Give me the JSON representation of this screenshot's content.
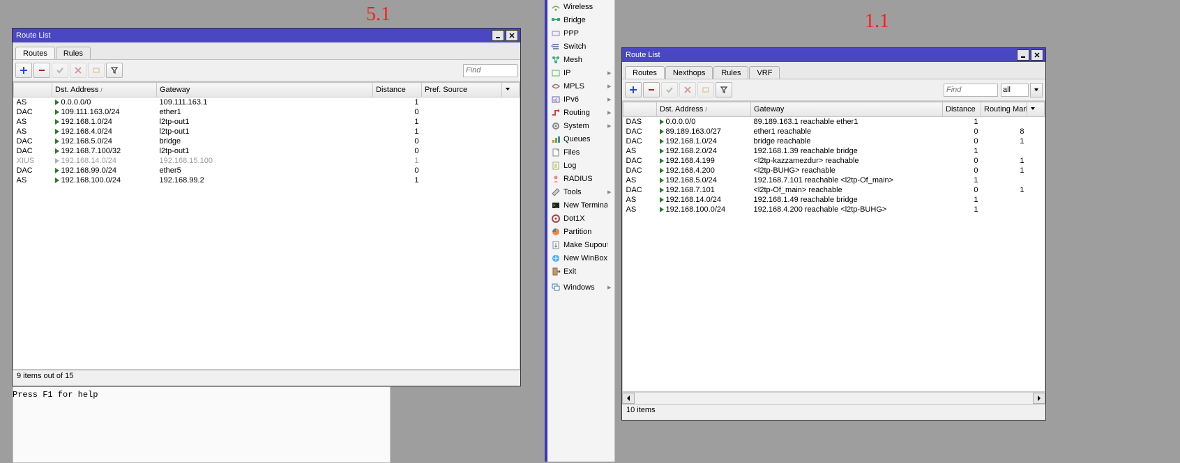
{
  "annotation_left": "5.1",
  "annotation_right": "1.1",
  "f1_help_text": "Press F1 for help",
  "window_a": {
    "title": "Route List",
    "tabs": [
      {
        "label": "Routes",
        "active": true
      },
      {
        "label": "Rules",
        "active": false
      }
    ],
    "find_placeholder": "Find",
    "columns": [
      "",
      "Dst. Address",
      "Gateway",
      "Distance",
      "Pref. Source"
    ],
    "rows": [
      {
        "flag": "AS",
        "dst": "0.0.0.0/0",
        "gw": "109.111.163.1",
        "dist": "1",
        "pref": ""
      },
      {
        "flag": "DAC",
        "dst": "109.111.163.0/24",
        "gw": "ether1",
        "dist": "0",
        "pref": ""
      },
      {
        "flag": "AS",
        "dst": "192.168.1.0/24",
        "gw": "l2tp-out1",
        "dist": "1",
        "pref": ""
      },
      {
        "flag": "AS",
        "dst": "192.168.4.0/24",
        "gw": "l2tp-out1",
        "dist": "1",
        "pref": ""
      },
      {
        "flag": "DAC",
        "dst": "192.168.5.0/24",
        "gw": "bridge",
        "dist": "0",
        "pref": ""
      },
      {
        "flag": "DAC",
        "dst": "192.168.7.100/32",
        "gw": "l2tp-out1",
        "dist": "0",
        "pref": ""
      },
      {
        "flag": "XIUS",
        "dst": "192.168.14.0/24",
        "gw": "192.168.15.100",
        "dist": "1",
        "pref": "",
        "disabled": true
      },
      {
        "flag": "DAC",
        "dst": "192.168.99.0/24",
        "gw": "ether5",
        "dist": "0",
        "pref": ""
      },
      {
        "flag": "AS",
        "dst": "192.168.100.0/24",
        "gw": "192.168.99.2",
        "dist": "1",
        "pref": ""
      }
    ],
    "status": "9 items out of 15"
  },
  "menu_items": [
    {
      "icon": "wireless",
      "label": "Wireless"
    },
    {
      "icon": "bridge",
      "label": "Bridge"
    },
    {
      "icon": "ppp",
      "label": "PPP"
    },
    {
      "icon": "switch",
      "label": "Switch"
    },
    {
      "icon": "mesh",
      "label": "Mesh"
    },
    {
      "icon": "ip",
      "label": "IP",
      "sub": true
    },
    {
      "icon": "mpls",
      "label": "MPLS",
      "sub": true
    },
    {
      "icon": "ipv6",
      "label": "IPv6",
      "sub": true
    },
    {
      "icon": "routing",
      "label": "Routing",
      "sub": true
    },
    {
      "icon": "system",
      "label": "System",
      "sub": true
    },
    {
      "icon": "queues",
      "label": "Queues"
    },
    {
      "icon": "files",
      "label": "Files"
    },
    {
      "icon": "log",
      "label": "Log"
    },
    {
      "icon": "radius",
      "label": "RADIUS"
    },
    {
      "icon": "tools",
      "label": "Tools",
      "sub": true
    },
    {
      "icon": "terminal",
      "label": "New Terminal"
    },
    {
      "icon": "dot1x",
      "label": "Dot1X"
    },
    {
      "icon": "partition",
      "label": "Partition"
    },
    {
      "icon": "supout",
      "label": "Make Supout.rif"
    },
    {
      "icon": "winbox",
      "label": "New WinBox"
    },
    {
      "icon": "exit",
      "label": "Exit"
    },
    {
      "separator": true
    },
    {
      "icon": "windows",
      "label": "Windows",
      "sub": true
    }
  ],
  "window_b": {
    "title": "Route List",
    "tabs": [
      {
        "label": "Routes",
        "active": true
      },
      {
        "label": "Nexthops",
        "active": false
      },
      {
        "label": "Rules",
        "active": false
      },
      {
        "label": "VRF",
        "active": false
      }
    ],
    "find_placeholder": "Find",
    "all_label": "all",
    "columns": [
      "",
      "Dst. Address",
      "Gateway",
      "Distance",
      "Routing Mark"
    ],
    "rows": [
      {
        "flag": "DAS",
        "dst": "0.0.0.0/0",
        "gw": "89.189.163.1 reachable ether1",
        "dist": "1",
        "mark": ""
      },
      {
        "flag": "DAC",
        "dst": "89.189.163.0/27",
        "gw": "ether1 reachable",
        "dist": "0",
        "mark": "8"
      },
      {
        "flag": "DAC",
        "dst": "192.168.1.0/24",
        "gw": "bridge reachable",
        "dist": "0",
        "mark": "1"
      },
      {
        "flag": "AS",
        "dst": "192.168.2.0/24",
        "gw": "192.168.1.39 reachable bridge",
        "dist": "1",
        "mark": ""
      },
      {
        "flag": "DAC",
        "dst": "192.168.4.199",
        "gw": "<l2tp-kazzamezdur> reachable",
        "dist": "0",
        "mark": "1"
      },
      {
        "flag": "DAC",
        "dst": "192.168.4.200",
        "gw": "<l2tp-BUHG> reachable",
        "dist": "0",
        "mark": "1"
      },
      {
        "flag": "AS",
        "dst": "192.168.5.0/24",
        "gw": "192.168.7.101 reachable <l2tp-Of_main>",
        "dist": "1",
        "mark": ""
      },
      {
        "flag": "DAC",
        "dst": "192.168.7.101",
        "gw": "<l2tp-Of_main> reachable",
        "dist": "0",
        "mark": "1"
      },
      {
        "flag": "AS",
        "dst": "192.168.14.0/24",
        "gw": "192.168.1.49 reachable bridge",
        "dist": "1",
        "mark": ""
      },
      {
        "flag": "AS",
        "dst": "192.168.100.0/24",
        "gw": "192.168.4.200 reachable <l2tp-BUHG>",
        "dist": "1",
        "mark": ""
      }
    ],
    "status": "10 items"
  }
}
